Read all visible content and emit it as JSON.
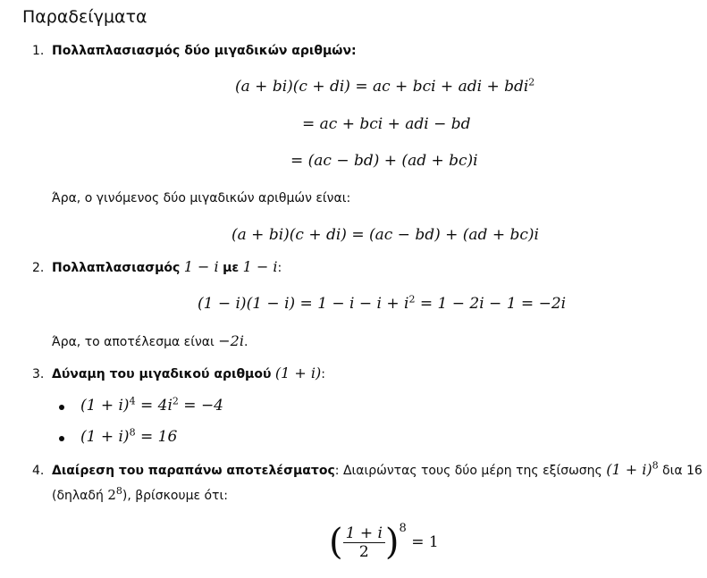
{
  "heading": "Παραδείγματα",
  "item1": {
    "number": "1.",
    "title": "Πολλαπλασιασμός δύο μιγαδικών αριθμών:",
    "eq_line1": "(a + bi)(c + di) = ac + bci + adi + bdi",
    "eq_line1_exp": "2",
    "eq_line2": "= ac + bci + adi − bd",
    "eq_line3": "= (ac − bd) + (ad + bc)i",
    "note": "Άρα, ο γινόμενος δύο μιγαδικών αριθμών είναι:",
    "eq_result": "(a + bi)(c + di) = (ac − bd) + (ad + bc)i"
  },
  "item2": {
    "number": "2.",
    "title_bold_a": "Πολλαπλασιασμός",
    "title_math_a": "1 − i",
    "title_bold_b": "με",
    "title_math_b": "1 − i",
    "title_end": ":",
    "eq_pre": "(1 − i)(1 − i) = 1 − i − i + i",
    "eq_exp": "2",
    "eq_post": " = 1 − 2i − 1 = −2i",
    "note_pre": "Άρα, το αποτέλεσμα είναι",
    "note_math": "−2i",
    "note_end": "."
  },
  "item3": {
    "number": "3.",
    "title_bold": "Δύναμη του μιγαδικού αριθμού",
    "title_math": "(1 + i)",
    "title_end": ":",
    "bullet1_a": "(1 + i)",
    "bullet1_exp1": "4",
    "bullet1_b": " = 4i",
    "bullet1_exp2": "2",
    "bullet1_c": " = −4",
    "bullet2_a": "(1 + i)",
    "bullet2_exp": "8",
    "bullet2_b": " = 16"
  },
  "item4": {
    "number": "4.",
    "title_bold": "Διαίρεση του παραπάνω αποτελέσματος",
    "title_rest": ": Διαιρώντας τους δύο μέρη της εξίσωσης",
    "title_math": "(1 + i)",
    "title_math_exp": "8",
    "title_tail": " δια 16",
    "line2_pre": "(δηλαδή",
    "line2_math": "2",
    "line2_exp": "8",
    "line2_post": "), βρίσκουμε ότι:",
    "frac_num": "1 + i",
    "frac_den": "2",
    "frac_exp": "8",
    "frac_rhs": "= 1"
  }
}
